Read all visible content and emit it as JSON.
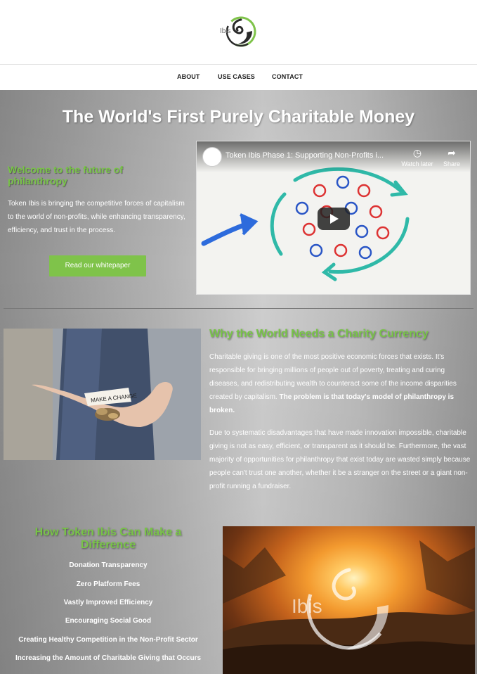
{
  "brand": {
    "logo_text": "Ibis"
  },
  "nav": {
    "items": [
      "ABOUT",
      "USE CASES",
      "CONTACT"
    ]
  },
  "hero": {
    "title": "The World's First Purely Charitable Money",
    "welcome_heading": "Welcome to the future of philanthropy",
    "intro": "Token Ibis is bringing the competitive forces of capitalism to the world of non-profits, while enhancing transparency, efficiency, and trust in the process.",
    "button_label": "Read our whitepaper"
  },
  "video": {
    "title": "Token Ibis Phase 1: Supporting Non-Profits i...",
    "watch_later": "Watch later",
    "share": "Share"
  },
  "photo1": {
    "note_text": "MAKE A CHANGE"
  },
  "why": {
    "title": "Why the World Needs a Charity Currency",
    "p1": "Charitable giving is one of the most positive economic forces that exists. It's responsible for bringing millions of people out of poverty, treating and curing diseases, and redistributing wealth to counteract some of the income disparities created by capitalism. ",
    "p1_bold": "The problem is that today's model of philanthropy is broken.",
    "p2": "Due to systematic disadvantages that have made innovation impossible, charitable giving is not as easy, efficient, or transparent as it should be. Furthermore, the vast majority of opportunities for philanthropy that exist today are wasted simply because people can't trust one another, whether it be a stranger on the street or a giant non-profit running a fundraiser."
  },
  "how": {
    "title": "How Token Ibis Can Make a Difference",
    "benefits": [
      "Donation Transparency",
      "Zero Platform Fees",
      "Vastly Improved Efficiency",
      "Encouraging Social Good",
      "Creating Healthy Competition in the Non-Profit Sector",
      "Increasing the Amount of Charitable Giving that Occurs"
    ]
  },
  "photo2": {
    "logo_text": "Ibis"
  },
  "colors": {
    "accent_green": "#7fc34a",
    "heading_green": "#78c447"
  }
}
